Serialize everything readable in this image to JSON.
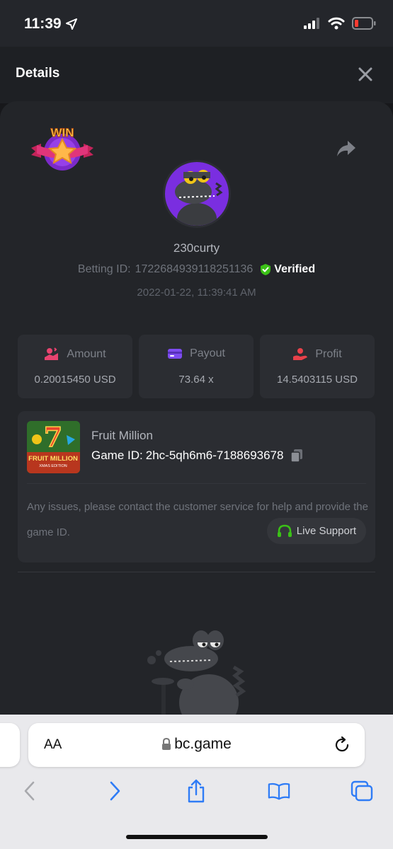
{
  "status_bar": {
    "time": "11:39"
  },
  "header": {
    "title": "Details"
  },
  "bet": {
    "win_badge": "WIN",
    "username": "230curty",
    "betting_id_label": "Betting ID:",
    "betting_id": "1722684939118251136",
    "verified_label": "Verified",
    "datetime": "2022-01-22, 11:39:41 AM"
  },
  "stats": [
    {
      "label": "Amount",
      "value": "0.20015450 USD"
    },
    {
      "label": "Payout",
      "value": "73.64 x"
    },
    {
      "label": "Profit",
      "value": "14.5403115 USD"
    }
  ],
  "game": {
    "thumb_title": "FRUIT MILLION",
    "thumb_subtitle": "XMAS EDITION",
    "name": "Fruit Million",
    "id_label": "Game ID:",
    "id": "2hc-5qh6m6-7188693678",
    "notice": "Any issues, please contact the customer service for help and provide the game ID.",
    "support_label": "Live Support"
  },
  "browser": {
    "aa_label": "AA",
    "url": "bc.game"
  },
  "colors": {
    "background": "#17181b",
    "sheet": "#232529",
    "card": "#2b2d32",
    "verified_green": "#3bc117",
    "amount_pink": "#e8436f",
    "payout_purple": "#7e4cf0",
    "profit_red": "#e8414a",
    "support_green": "#3bc117",
    "ios_blue": "#2f7cf6"
  },
  "icons": [
    "location-arrow-icon",
    "signal-icon",
    "wifi-icon",
    "battery-low-icon",
    "close-icon",
    "share-icon",
    "verified-shield-icon",
    "amount-icon",
    "payout-card-icon",
    "profit-hand-icon",
    "copy-icon",
    "headset-icon",
    "lock-icon",
    "reload-icon",
    "back-icon",
    "forward-icon",
    "share-sheet-icon",
    "bookmarks-icon",
    "tabs-icon"
  ]
}
